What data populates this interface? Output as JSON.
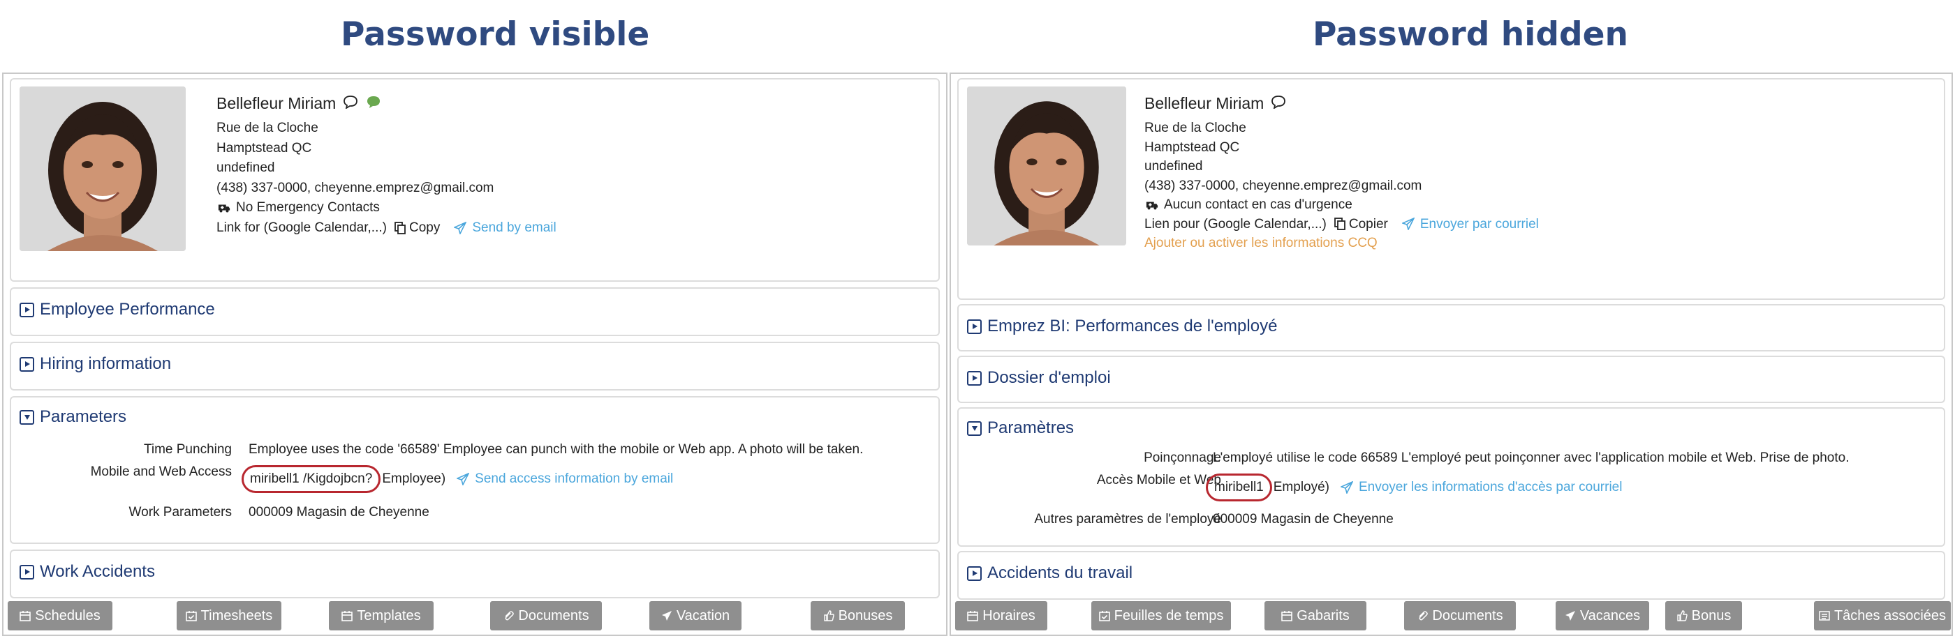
{
  "headings": {
    "left": "Password visible",
    "right": "Password hidden"
  },
  "colors": {
    "heading": "#2f4a80",
    "section_title": "#1f3a73",
    "link": "#4aa6dc",
    "orange": "#e3a04f",
    "button_bg": "#8f8f8f",
    "highlight": "#b8272f"
  },
  "left": {
    "profile": {
      "name": "Bellefleur Miriam",
      "address1": "Rue de la Cloche",
      "address2": "Hamptstead QC",
      "extra": "undefined",
      "contact": "(438) 337-0000, cheyenne.emprez@gmail.com",
      "emergency": "No Emergency Contacts",
      "link_label": "Link for (Google Calendar,...)",
      "copy": "Copy",
      "send_email": "Send by email"
    },
    "sections": {
      "performance": "Employee Performance",
      "hiring": "Hiring information",
      "parameters": "Parameters",
      "accidents": "Work Accidents"
    },
    "params": {
      "punch_label": "Time Punching",
      "punch_value": "Employee uses the code '66589' Employee can punch with the mobile or Web app. A photo will be taken.",
      "access_label": "Mobile and Web Access",
      "access_credentials": "miribell1 /Kigdojbcn?",
      "access_role": "Employee)",
      "access_link": "Send access information by email",
      "work_label": "Work Parameters",
      "work_value": "000009 Magasin de Cheyenne"
    },
    "buttons": [
      "Schedules",
      "Timesheets",
      "Templates",
      "Documents",
      "Vacation",
      "Bonuses"
    ]
  },
  "right": {
    "profile": {
      "name": "Bellefleur Miriam",
      "address1": "Rue de la Cloche",
      "address2": "Hamptstead QC",
      "extra": "undefined",
      "contact": "(438) 337-0000, cheyenne.emprez@gmail.com",
      "emergency": "Aucun contact en cas d'urgence",
      "link_label": "Lien pour (Google Calendar,...)",
      "copy": "Copier",
      "send_email": "Envoyer par courriel",
      "ccq": "Ajouter ou activer les informations CCQ"
    },
    "sections": {
      "performance": "Emprez BI: Performances de l'employé",
      "hiring": "Dossier d'emploi",
      "parameters": "Paramètres",
      "accidents": "Accidents du travail"
    },
    "params": {
      "punch_label": "Poinçonnage",
      "punch_value": "L'employé utilise le code 66589 L'employé peut poinçonner avec l'application mobile et Web. Prise de photo.",
      "access_label": "Accès Mobile et Web",
      "access_credentials": "miribell1",
      "access_role": "Employé)",
      "access_link": "Envoyer les informations d'accès par courriel",
      "work_label": "Autres paramètres de l'employé",
      "work_value": "000009 Magasin de Cheyenne"
    },
    "buttons": [
      "Horaires",
      "Feuilles de temps",
      "Gabarits",
      "Documents",
      "Vacances",
      "Bonus",
      "Tâches associées"
    ]
  }
}
